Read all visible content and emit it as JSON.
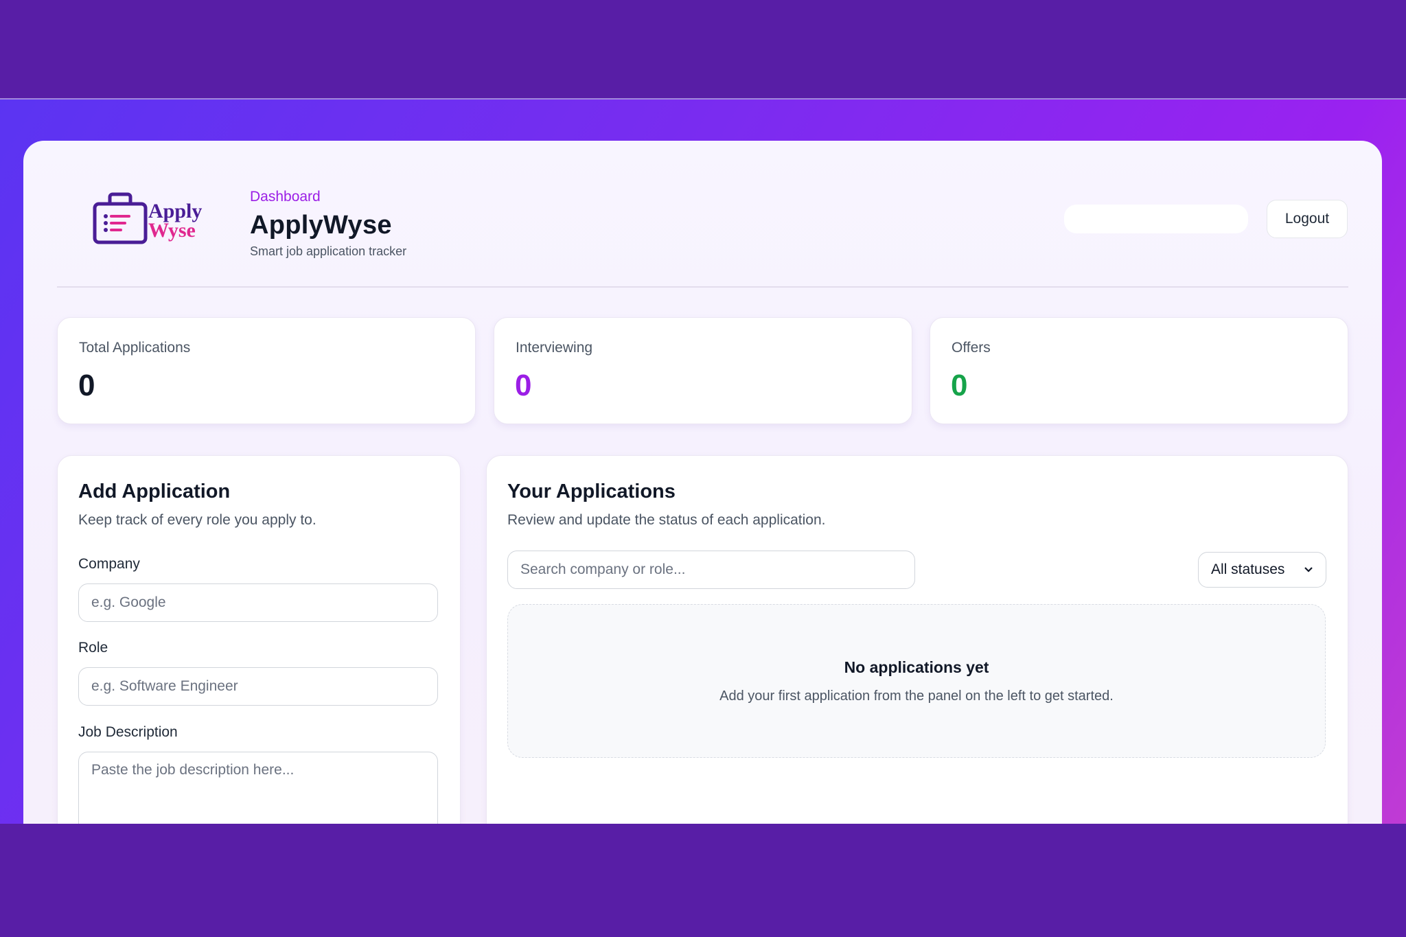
{
  "colors": {
    "accent": "#9b1ee6",
    "interviewing": "#9b1ee6",
    "offers": "#16a34a",
    "total": "#111827",
    "logo_purple": "#4a1d96",
    "logo_pink": "#e0288f"
  },
  "header": {
    "logo_line1": "Apply",
    "logo_line2": "Wyse",
    "breadcrumb": "Dashboard",
    "title": "ApplyWyse",
    "subtitle": "Smart job application tracker",
    "logout_label": "Logout"
  },
  "stats": [
    {
      "label": "Total Applications",
      "value": "0"
    },
    {
      "label": "Interviewing",
      "value": "0"
    },
    {
      "label": "Offers",
      "value": "0"
    }
  ],
  "add_form": {
    "title": "Add Application",
    "description": "Keep track of every role you apply to.",
    "company_label": "Company",
    "company_placeholder": "e.g. Google",
    "role_label": "Role",
    "role_placeholder": "e.g. Software Engineer",
    "jd_label": "Job Description",
    "jd_placeholder": "Paste the job description here..."
  },
  "applications": {
    "title": "Your Applications",
    "description": "Review and update the status of each application.",
    "search_placeholder": "Search company or role...",
    "status_filter": "All statuses",
    "empty_title": "No applications yet",
    "empty_subtitle": "Add your first application from the panel on the left to get started."
  }
}
